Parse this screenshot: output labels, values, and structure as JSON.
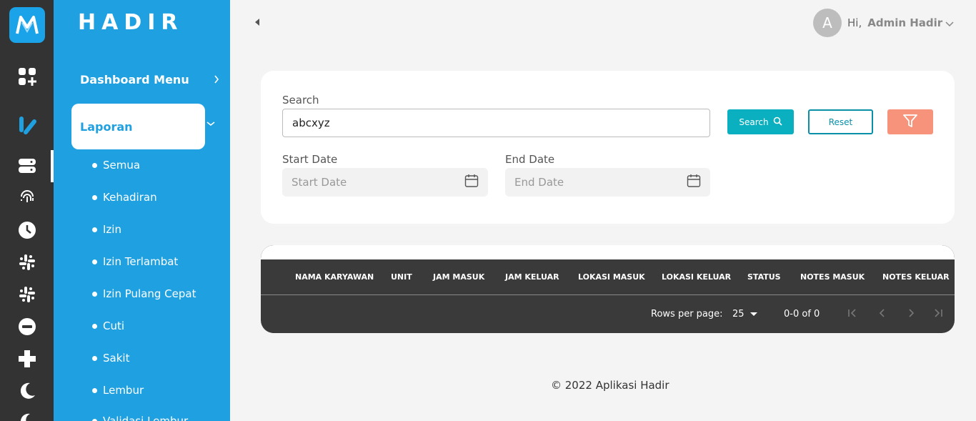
{
  "app": {
    "brand": "HADIR"
  },
  "rail": {
    "icons": [
      "app-logo-icon",
      "apps-add-icon",
      "chart-icon",
      "server-icon",
      "fingerprint-icon",
      "clock-icon",
      "slack-icon",
      "slack-icon-2",
      "minus-circle-icon",
      "plus-icon",
      "moon-icon",
      "moon-icon-2"
    ]
  },
  "sidebar": {
    "dashboard_label": "Dashboard Menu",
    "active_label": "Laporan",
    "subitems": [
      "Semua",
      "Kehadiran",
      "Izin",
      "Izin Terlambat",
      "Izin Pulang Cepat",
      "Cuti",
      "Sakit",
      "Lembur",
      "Validasi Lembur"
    ]
  },
  "header": {
    "avatar_letter": "A",
    "greeting": "Hi,",
    "username": "Admin Hadir"
  },
  "search_card": {
    "search_label": "Search",
    "search_value": "abcxyz",
    "search_button": "Search",
    "reset_button": "Reset",
    "start_date_label": "Start Date",
    "start_date_placeholder": "Start Date",
    "end_date_label": "End Date",
    "end_date_placeholder": "End Date"
  },
  "table": {
    "columns": [
      "NAMA KARYAWAN",
      "UNIT",
      "JAM MASUK",
      "JAM KELUAR",
      "LOKASI MASUK",
      "LOKASI KELUAR",
      "STATUS",
      "NOTES MASUK",
      "NOTES KELUAR"
    ],
    "rows_per_page_label": "Rows per page:",
    "rows_per_page_value": "25",
    "range_text": "0-0 of 0"
  },
  "footer": {
    "text": "© 2022 Aplikasi Hadir"
  },
  "colors": {
    "sidebar": "#1fa0e0",
    "rail": "#333333",
    "search_button": "#0ab0bf",
    "filter_button": "#f7937a",
    "table": "#3a3a3a"
  }
}
